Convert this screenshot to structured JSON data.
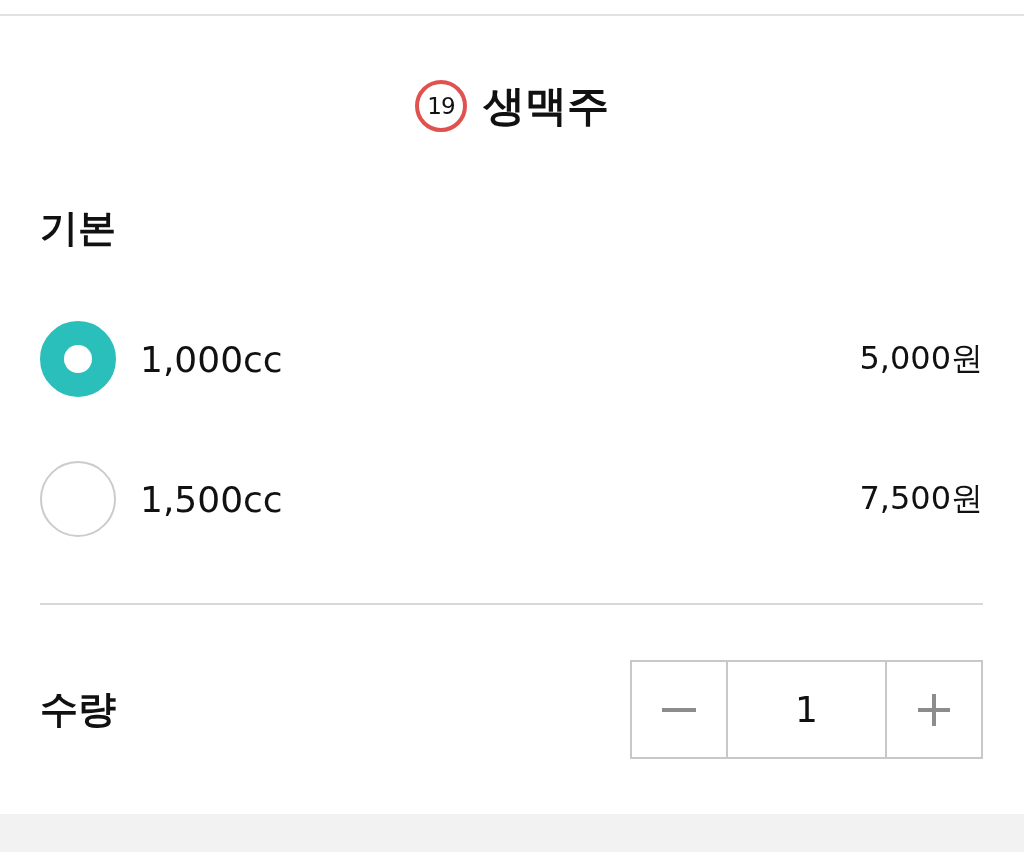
{
  "product": {
    "age_badge": "19",
    "title": "생맥주"
  },
  "option_group": {
    "title": "기본",
    "options": [
      {
        "label": "1,000cc",
        "price": "5,000원",
        "selected": true
      },
      {
        "label": "1,500cc",
        "price": "7,500원",
        "selected": false
      }
    ]
  },
  "quantity": {
    "label": "수량",
    "value": "1"
  }
}
